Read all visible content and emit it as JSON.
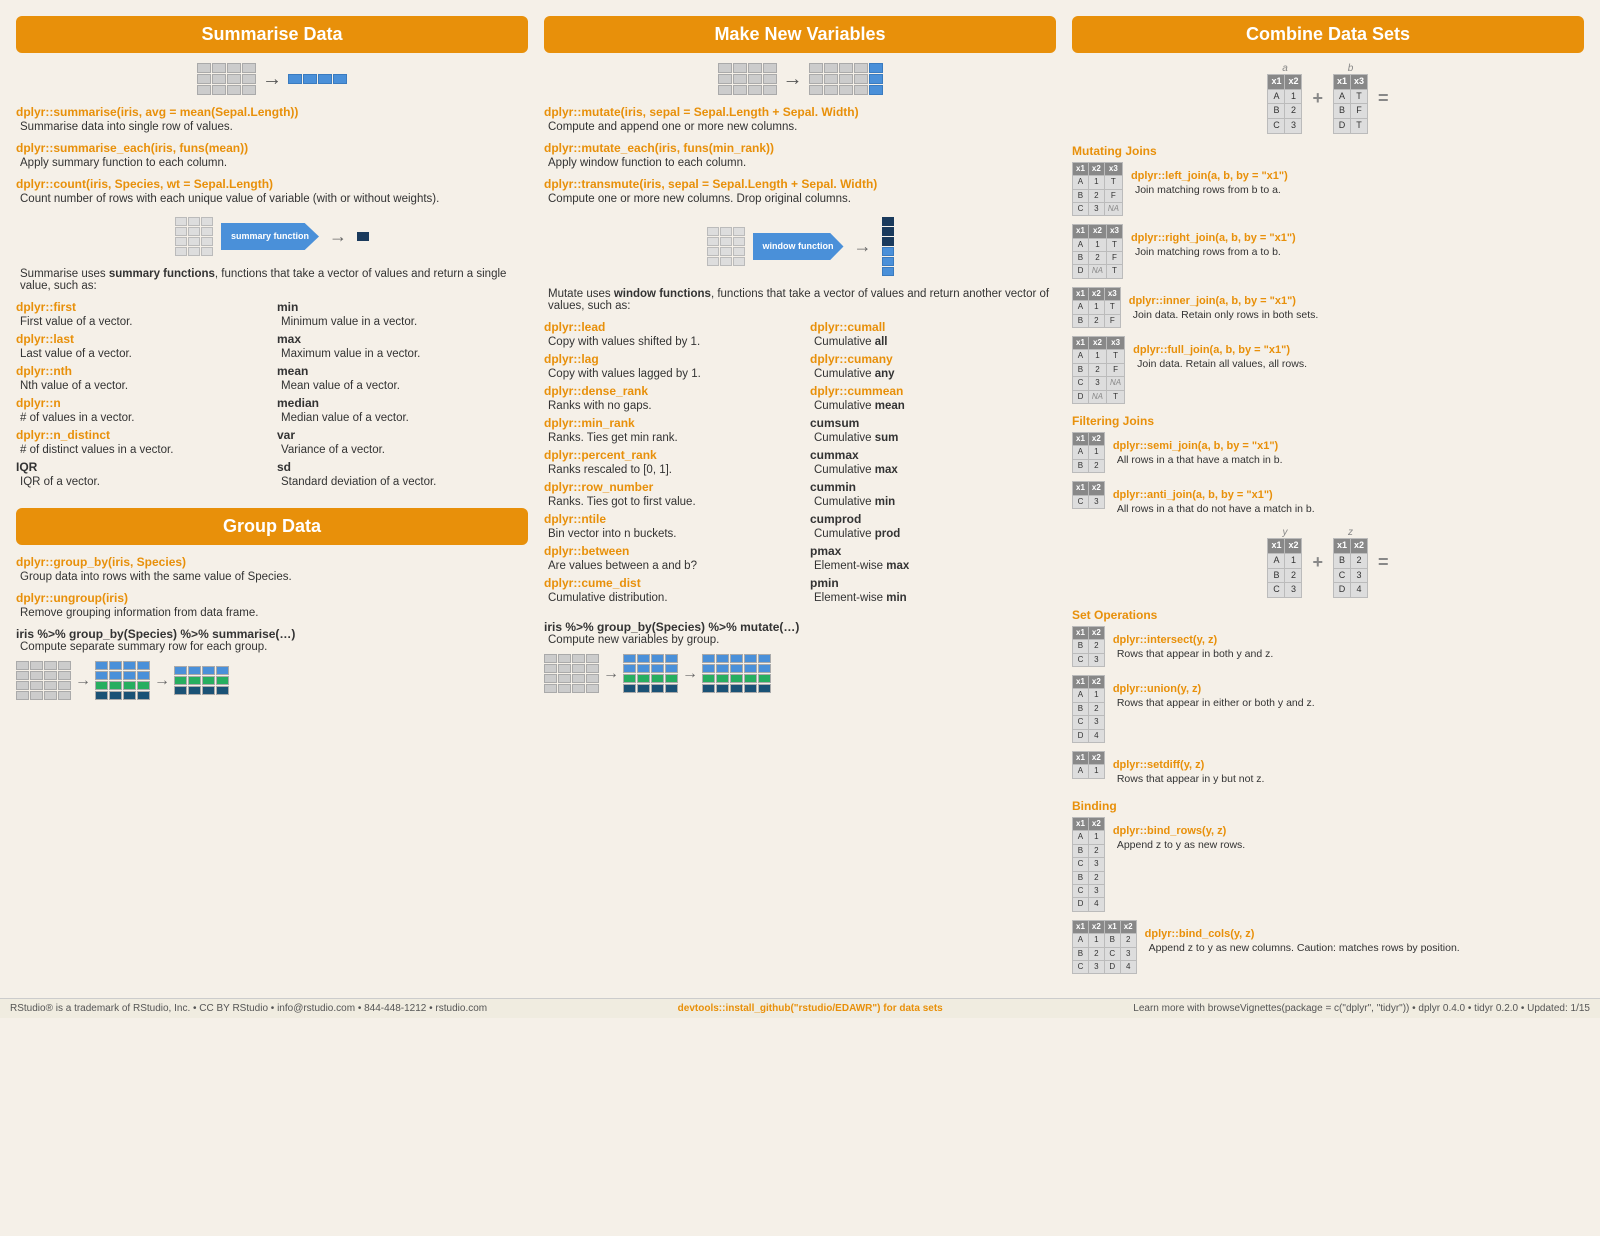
{
  "sections": {
    "summarise": {
      "title": "Summarise Data",
      "intro_code": "dplyr::summarise(iris, avg = mean(Sepal.Length))",
      "intro_desc": "Summarise data into single row of values.",
      "code2": "dplyr::summarise_each(iris, funs(mean))",
      "desc2": "Apply summary function to each column.",
      "code3": "dplyr::count(iris, Species, wt = Sepal.Length)",
      "desc3": "Count number of rows with each unique value of variable (with or without weights).",
      "summary_para": "Summarise uses summary functions, functions that take a vector of values and return a single value, such as:",
      "functions": [
        {
          "code": "dplyr::first",
          "label": "First value of a vector."
        },
        {
          "code": "dplyr::last",
          "label": "Last value of a vector."
        },
        {
          "code": "dplyr::nth",
          "label": "Nth value of a vector."
        },
        {
          "code": "dplyr::n",
          "label": "# of values in a vector."
        },
        {
          "code": "dplyr::n_distinct",
          "label": "# of distinct values in a vector."
        },
        {
          "code": "IQR",
          "label": "IQR of a vector."
        }
      ],
      "functions_right": [
        {
          "code": "min",
          "label": "Minimum value in a vector."
        },
        {
          "code": "max",
          "label": "Maximum value in a vector."
        },
        {
          "code": "mean",
          "label": "Mean value of a vector."
        },
        {
          "code": "median",
          "label": "Median value of a vector."
        },
        {
          "code": "var",
          "label": "Variance of a vector."
        },
        {
          "code": "sd",
          "label": "Standard deviation of a vector."
        }
      ]
    },
    "make_new": {
      "title": "Make New Variables",
      "code1": "dplyr::mutate(iris, sepal = Sepal.Length + Sepal. Width)",
      "desc1": "Compute and append one or more new columns.",
      "code2": "dplyr::mutate_each(iris, funs(min_rank))",
      "desc2": "Apply window function to each column.",
      "code3": "dplyr::transmute(iris, sepal = Sepal.Length + Sepal. Width)",
      "desc3": "Compute one or more new columns. Drop original columns.",
      "window_para": "Mutate uses window functions, functions that take a vector of values and return another vector of values, such as:",
      "funcs_left": [
        {
          "code": "dplyr::lead",
          "label": "Copy with values shifted by 1."
        },
        {
          "code": "dplyr::lag",
          "label": "Copy with values lagged by 1."
        },
        {
          "code": "dplyr::dense_rank",
          "label": "Ranks with no gaps."
        },
        {
          "code": "dplyr::min_rank",
          "label": "Ranks. Ties get min rank."
        },
        {
          "code": "dplyr::percent_rank",
          "label": "Ranks rescaled to [0, 1]."
        },
        {
          "code": "dplyr::row_number",
          "label": "Ranks. Ties got to first value."
        },
        {
          "code": "dplyr::ntile",
          "label": "Bin vector into n buckets."
        },
        {
          "code": "dplyr::between",
          "label": "Are values between a and b?"
        },
        {
          "code": "dplyr::cume_dist",
          "label": "Cumulative distribution."
        }
      ],
      "funcs_right": [
        {
          "code": "dplyr::cumall",
          "label": "Cumulative all"
        },
        {
          "code": "dplyr::cumany",
          "label": "Cumulative any"
        },
        {
          "code": "dplyr::cummean",
          "label": "Cumulative mean"
        },
        {
          "code": "cumsum",
          "label": "Cumulative sum"
        },
        {
          "code": "cummax",
          "label": "Cumulative max"
        },
        {
          "code": "cummin",
          "label": "Cumulative min"
        },
        {
          "code": "cumprod",
          "label": "Cumulative prod"
        },
        {
          "code": "pmax",
          "label": "Element-wise max"
        },
        {
          "code": "pmin",
          "label": "Element-wise min"
        }
      ],
      "pipe1": "iris %>% group_by(Species) %>% mutate(…)",
      "pipe1_desc": "Compute new variables by group."
    },
    "group": {
      "title": "Group Data",
      "code1": "dplyr::group_by(iris, Species)",
      "desc1": "Group data into rows with the same value of Species.",
      "code2": "dplyr::ungroup(iris)",
      "desc2": "Remove grouping information from data frame.",
      "pipe1": "iris %>% group_by(Species) %>% summarise(…)",
      "pipe1_desc": "Compute separate summary row for each group."
    },
    "combine": {
      "title": "Combine Data Sets",
      "mutating_joins_label": "Mutating Joins",
      "filtering_joins_label": "Filtering Joins",
      "set_ops_label": "Set Operations",
      "binding_label": "Binding",
      "joins": [
        {
          "code": "dplyr::left_join(a, b, by = \"x1\")",
          "desc": "Join matching rows from b to a."
        },
        {
          "code": "dplyr::right_join(a, b, by = \"x1\")",
          "desc": "Join matching rows from a to b."
        },
        {
          "code": "dplyr::inner_join(a, b, by = \"x1\")",
          "desc": "Join data. Retain only rows in both sets."
        },
        {
          "code": "dplyr::full_join(a, b, by = \"x1\")",
          "desc": "Join data. Retain all values, all rows."
        }
      ],
      "filter_joins": [
        {
          "code": "dplyr::semi_join(a, b, by = \"x1\")",
          "desc": "All rows in a that have a match in b."
        },
        {
          "code": "dplyr::anti_join(a, b, by = \"x1\")",
          "desc": "All rows in a that do not have a match in b."
        }
      ],
      "set_ops": [
        {
          "code": "dplyr::intersect(y, z)",
          "desc": "Rows that appear in both y and z."
        },
        {
          "code": "dplyr::union(y, z)",
          "desc": "Rows that appear in either or both y and z."
        },
        {
          "code": "dplyr::setdiff(y, z)",
          "desc": "Rows that appear in y but not z."
        }
      ],
      "binding": [
        {
          "code": "dplyr::bind_rows(y, z)",
          "desc": "Append z to y as new rows."
        },
        {
          "code": "dplyr::bind_cols(y, z)",
          "desc": "Append z to y as new columns. Caution: matches rows by position."
        }
      ]
    }
  },
  "footer": {
    "left": "RStudio® is a trademark of RStudio, Inc. • CC BY RStudio • info@rstudio.com • 844-448-1212 • rstudio.com",
    "center": "devtools::install_github(\"rstudio/EDAWR\") for data sets",
    "right": "Learn more with browseVignettes(package = c(\"dplyr\", \"tidyr\")) • dplyr 0.4.0 • tidyr 0.2.0 • Updated: 1/15"
  },
  "labels": {
    "summary_function": "summary function",
    "window_function": "window function",
    "bold_summary": "summary functions",
    "bold_window": "window functions",
    "a_label": "a",
    "b_label": "b",
    "y_label": "y",
    "z_label": "z"
  }
}
